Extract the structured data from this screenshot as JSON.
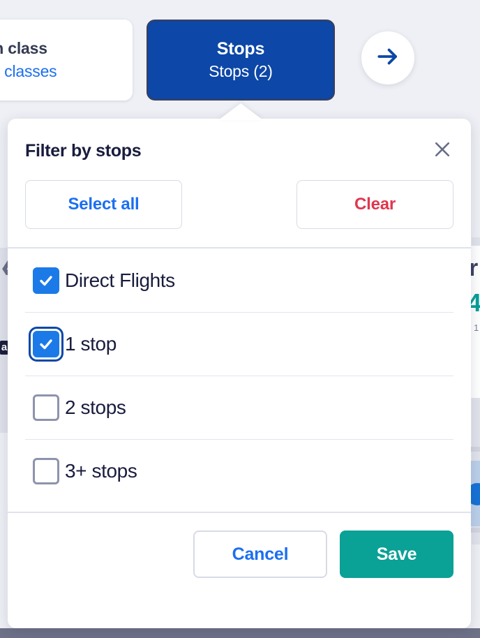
{
  "toolbar": {
    "cabin_card": {
      "title": "cabin class",
      "subtitle": "cabin classes"
    },
    "stops_button": {
      "title": "Stops",
      "subtitle": "Stops (2)"
    },
    "next_button": {
      "icon": "arrow-right-icon"
    }
  },
  "popover": {
    "title": "Filter by stops",
    "close_icon": "close-icon",
    "select_all_label": "Select all",
    "clear_label": "Clear",
    "options": [
      {
        "label": "Direct Flights",
        "checked": true,
        "focused": false
      },
      {
        "label": "1 stop",
        "checked": true,
        "focused": true
      },
      {
        "label": "2 stops",
        "checked": false,
        "focused": false
      },
      {
        "label": "3+ stops",
        "checked": false,
        "focused": false
      }
    ],
    "footer": {
      "cancel_label": "Cancel",
      "save_label": "Save"
    }
  },
  "background": {
    "left_glyph_1": "❮",
    "left_glyph_2": "a",
    "right_glyph_r": "r",
    "right_glyph_4": "4",
    "right_glyph_dots": "· 1"
  },
  "colors": {
    "page_background": "#eef0f5",
    "brand_blue": "#0d47a7",
    "link_blue": "#1b6ff0",
    "checkbox_blue": "#1b7ae8",
    "clear_red": "#e0364f",
    "save_teal": "#0aa196",
    "text_dark": "#191c3d",
    "divider": "#e3e5ee",
    "bottom_bar": "#6e7288"
  }
}
